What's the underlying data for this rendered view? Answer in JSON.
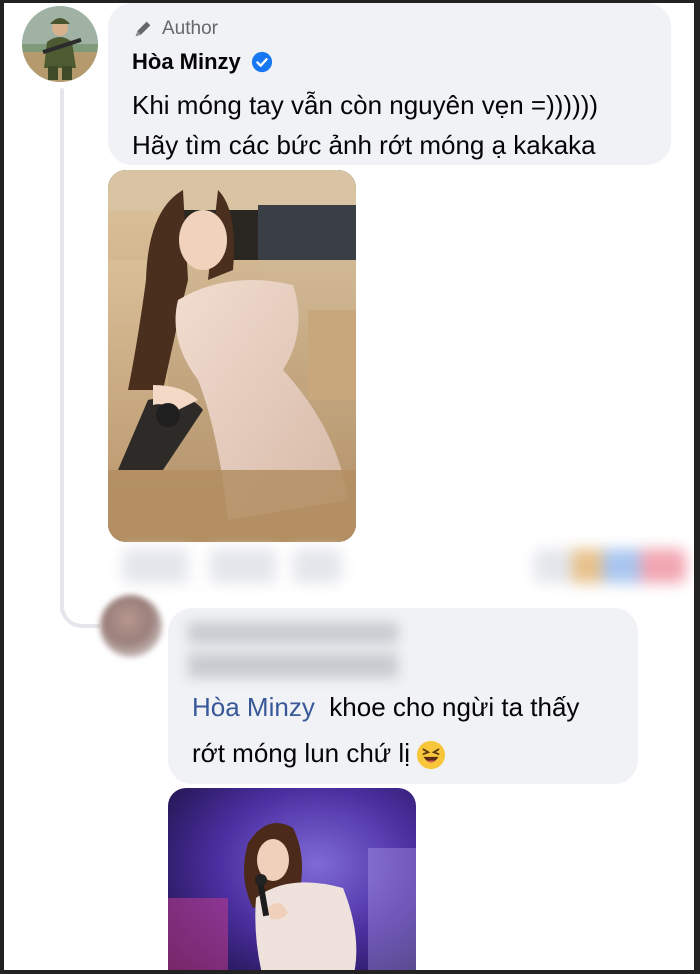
{
  "comment": {
    "badge": "Author",
    "author_name": "Hòa Minzy",
    "text_line1": "Khi móng tay vẫn còn nguyên vẹn =))))))",
    "text_line2": "Hãy tìm các bức ảnh rớt móng ạ kakaka"
  },
  "reply": {
    "mention": "Hòa Minzy",
    "text_after_mention": "khoe cho ngừi ta thấy",
    "text_line2": "rớt móng lun chứ lị"
  },
  "icons": {
    "badge_icon": "pen-icon",
    "verified_icon": "verified-badge-icon",
    "reaction_icon": "laughing-emoji-icon"
  },
  "colors": {
    "bubble": "#f0f2f5",
    "verified": "#1877f2",
    "mention": "#385898",
    "text": "#050505",
    "muted": "#65676b"
  }
}
